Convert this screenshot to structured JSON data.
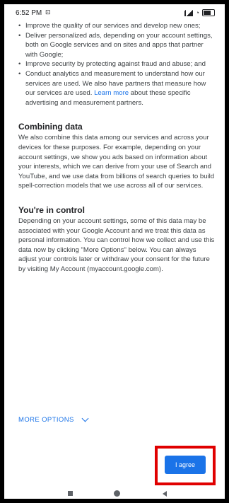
{
  "status_bar": {
    "time": "6:52 PM",
    "notification_icon": "notification-icon",
    "signal_icon": "signal-icon",
    "wifi_icon": "wifi-icon",
    "battery_icon": "battery-icon"
  },
  "bullets": [
    "Improve the quality of our services and develop new ones;",
    "Deliver personalized ads, depending on your account settings, both on Google services and on sites and apps that partner with Google;",
    "Improve security by protecting against fraud and abuse; and"
  ],
  "last_bullet": {
    "text_before": "Conduct analytics and measurement to understand how our services are used. We also have partners that measure how our services are used. ",
    "link_text": "Learn more",
    "text_after": " about these specific advertising and measurement partners."
  },
  "combining_data": {
    "heading": "Combining data",
    "body": "We also combine this data among our services and across your devices for these purposes. For example, depending on your account settings, we show you ads based on information about your interests, which we can derive from your use of Search and YouTube, and we use data from billions of search queries to build spell-correction models that we use across all of our services."
  },
  "in_control": {
    "heading": "You're in control",
    "body": "Depending on your account settings, some of this data may be associated with your Google Account and we treat this data as personal information. You can control how we collect and use this data now by clicking \"More Options\" below. You can always adjust your controls later or withdraw your consent for the future by visiting My Account (myaccount.google.com)."
  },
  "more_options_label": "MORE OPTIONS",
  "agree_label": "I agree",
  "colors": {
    "accent": "#1a73e8",
    "highlight": "#e00000",
    "text": "#3c4043"
  },
  "nav": {
    "recents_icon": "recents-square-icon",
    "home_icon": "home-circle-icon",
    "back_icon": "back-triangle-icon"
  }
}
